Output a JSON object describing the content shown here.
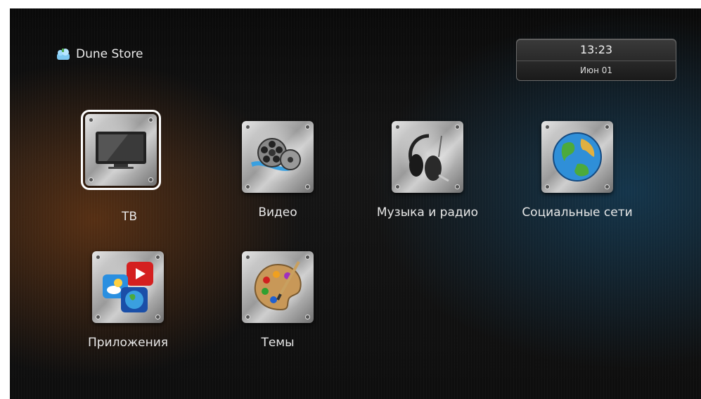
{
  "brand": {
    "label": "Dune Store",
    "icon": "dune-store-icon"
  },
  "clock": {
    "time": "13:23",
    "date": "Июн 01"
  },
  "tiles": [
    {
      "label": "ТВ",
      "icon": "tv-icon",
      "selected": true
    },
    {
      "label": "Видео",
      "icon": "film-reel-icon",
      "selected": false
    },
    {
      "label": "Музыка и радио",
      "icon": "headphones-icon",
      "selected": false
    },
    {
      "label": "Социальные сети",
      "icon": "globe-icon",
      "selected": false
    },
    {
      "label": "Приложения",
      "icon": "apps-icon",
      "selected": false
    },
    {
      "label": "Темы",
      "icon": "palette-icon",
      "selected": false
    }
  ]
}
